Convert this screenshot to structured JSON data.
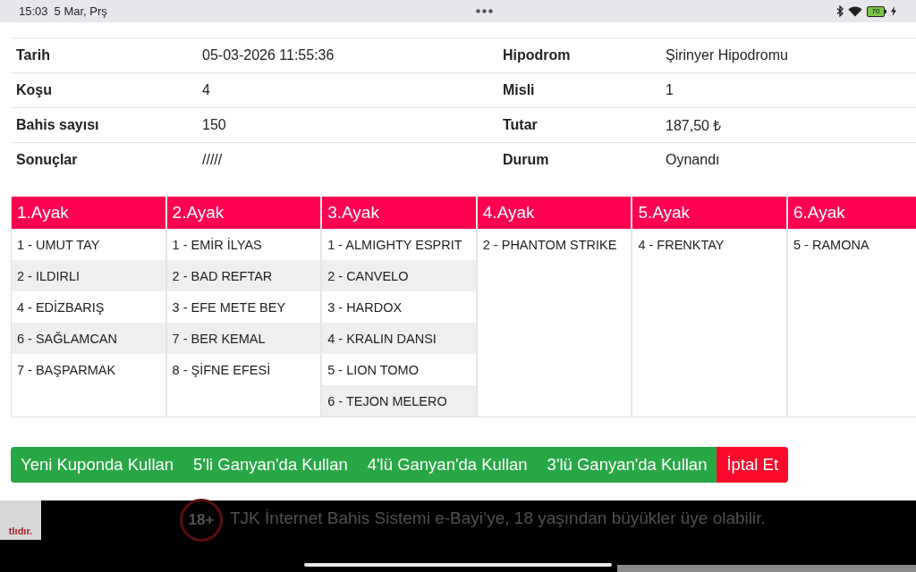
{
  "status_bar": {
    "time": "15:03",
    "date": "5 Mar, Prş",
    "battery": "70"
  },
  "details": [
    {
      "label": "Tarih",
      "value": "05-03-2026 11:55:36",
      "label_2": "Hipodrom",
      "value_2": "Şirinyer Hipodromu"
    },
    {
      "label": "Koşu",
      "value": "4",
      "label_2": "Misli",
      "value_2": "1"
    },
    {
      "label": "Bahis sayısı",
      "value": "150",
      "label_2": "Tutar",
      "value_2": "187,50 ₺"
    },
    {
      "label": "Sonuçlar",
      "value": "/////",
      "label_2": "Durum",
      "value_2": "Oynandı"
    }
  ],
  "legs": [
    {
      "title": "1.Ayak",
      "horses": [
        "1 - UMUT TAY",
        "2 - ILDIRLI",
        "4 - EDİZBARIŞ",
        "6 - SAĞLAMCAN",
        "7 - BAŞPARMAK"
      ]
    },
    {
      "title": "2.Ayak",
      "horses": [
        "1 - EMİR İLYAS",
        "2 - BAD REFTAR",
        "3 - EFE METE BEY",
        "7 - BER KEMAL",
        "8 - ŞİFNE EFESİ"
      ]
    },
    {
      "title": "3.Ayak",
      "horses": [
        "1 - ALMIGHTY ESPRIT",
        "2 - CANVELO",
        "3 - HARDOX",
        "4 - KRALIN DANSI",
        "5 - LION TOMO",
        "6 - TEJON MELERO"
      ]
    },
    {
      "title": "4.Ayak",
      "horses": [
        "2 - PHANTOM STRIKE"
      ]
    },
    {
      "title": "5.Ayak",
      "horses": [
        "4 - FRENKTAY"
      ]
    },
    {
      "title": "6.Ayak",
      "horses": [
        "5 - RAMONA"
      ]
    }
  ],
  "actions": [
    {
      "label": "Yeni Kuponda Kullan",
      "kind": "success"
    },
    {
      "label": "5'li Ganyan'da Kullan",
      "kind": "success"
    },
    {
      "label": "4'lü Ganyan'da Kullan",
      "kind": "success"
    },
    {
      "label": "3'lü Ganyan'da Kullan",
      "kind": "success"
    },
    {
      "label": "İptal Et",
      "kind": "danger"
    }
  ],
  "footer": {
    "badge_text": "tlıdır.",
    "age_mark": "18+",
    "notice": "TJK İnternet Bahis Sistemi e-Bayi’ye, 18 yaşından büyükler üye olabilir."
  }
}
